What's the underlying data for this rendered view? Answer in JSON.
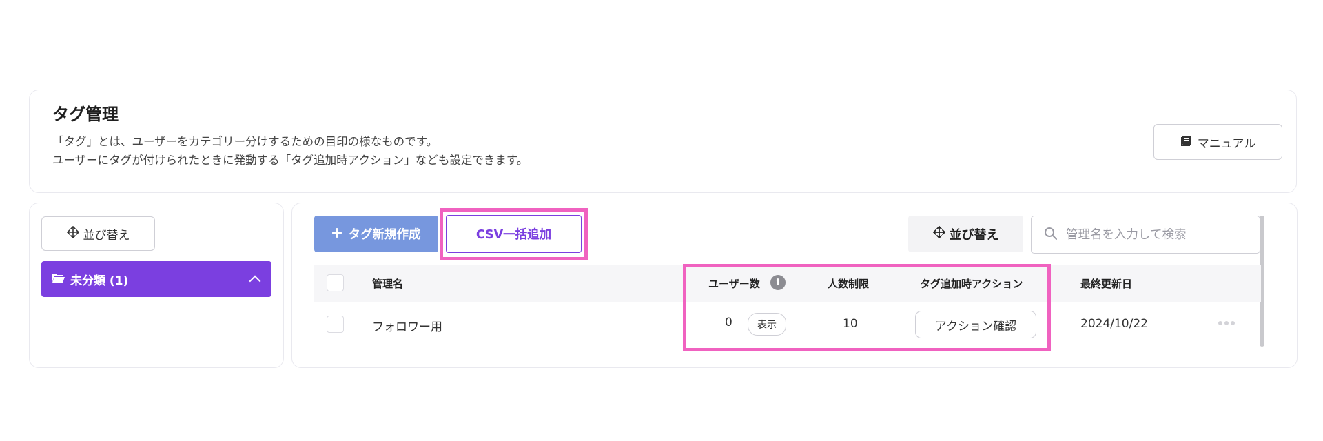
{
  "header": {
    "title": "タグ管理",
    "description_line1": "「タグ」とは、ユーザーをカテゴリー分けするための目印の様なものです。",
    "description_line2": "ユーザーにタグが付けられたときに発動する「タグ追加時アクション」なども設定できます。",
    "manual_label": "マニュアル",
    "manual_icon": "book-icon"
  },
  "sidebar": {
    "sort_label": "並び替え",
    "folder": {
      "label": "未分類 (1)",
      "icon": "folder-open-icon"
    }
  },
  "toolbar": {
    "new_tag_label": "タグ新規作成",
    "csv_label": "CSV一括追加",
    "sort_label": "並び替え",
    "search_placeholder": "管理名を入力して検索"
  },
  "table": {
    "columns": {
      "name": "管理名",
      "users": "ユーザー数",
      "limit": "人数制限",
      "action": "タグ追加時アクション",
      "updated": "最終更新日"
    },
    "info_symbol": "i",
    "rows": [
      {
        "name": "フォロワー用",
        "users": "0",
        "show_label": "表示",
        "limit": "10",
        "action_label": "アクション確認",
        "updated": "2024/10/22"
      }
    ]
  },
  "colors": {
    "accent_purple": "#7b3fe0",
    "new_button_blue": "#7797de",
    "highlight_pink": "#f062c0"
  }
}
